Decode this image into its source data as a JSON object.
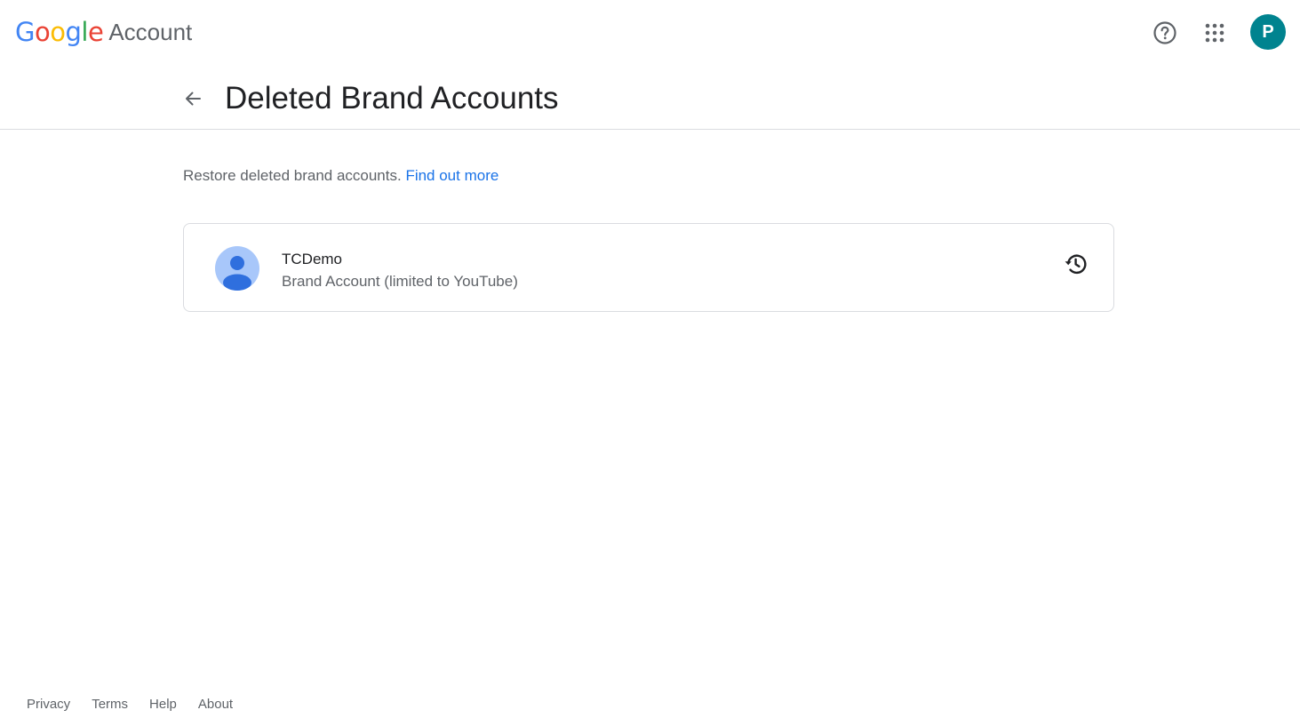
{
  "header": {
    "logo": {
      "letters": [
        {
          "char": "G",
          "color": "#4285F4"
        },
        {
          "char": "o",
          "color": "#EA4335"
        },
        {
          "char": "o",
          "color": "#FBBC05"
        },
        {
          "char": "g",
          "color": "#4285F4"
        },
        {
          "char": "l",
          "color": "#34A853"
        },
        {
          "char": "e",
          "color": "#EA4335"
        }
      ],
      "product": "Account"
    },
    "help_icon": "help-circle-icon",
    "apps_icon": "apps-grid-icon",
    "avatar_letter": "P",
    "avatar_color": "#00838f"
  },
  "page": {
    "back_icon": "arrow-back-icon",
    "title": "Deleted Brand Accounts",
    "intro_text": "Restore deleted brand accounts. ",
    "intro_link": "Find out more",
    "link_color": "#1a73e8"
  },
  "accounts": [
    {
      "name": "TCDemo",
      "type": "Brand Account (limited to YouTube)",
      "avatar_icon": "person-icon",
      "action_icon": "restore-history-icon"
    }
  ],
  "footer": {
    "links": [
      "Privacy",
      "Terms",
      "Help",
      "About"
    ]
  }
}
